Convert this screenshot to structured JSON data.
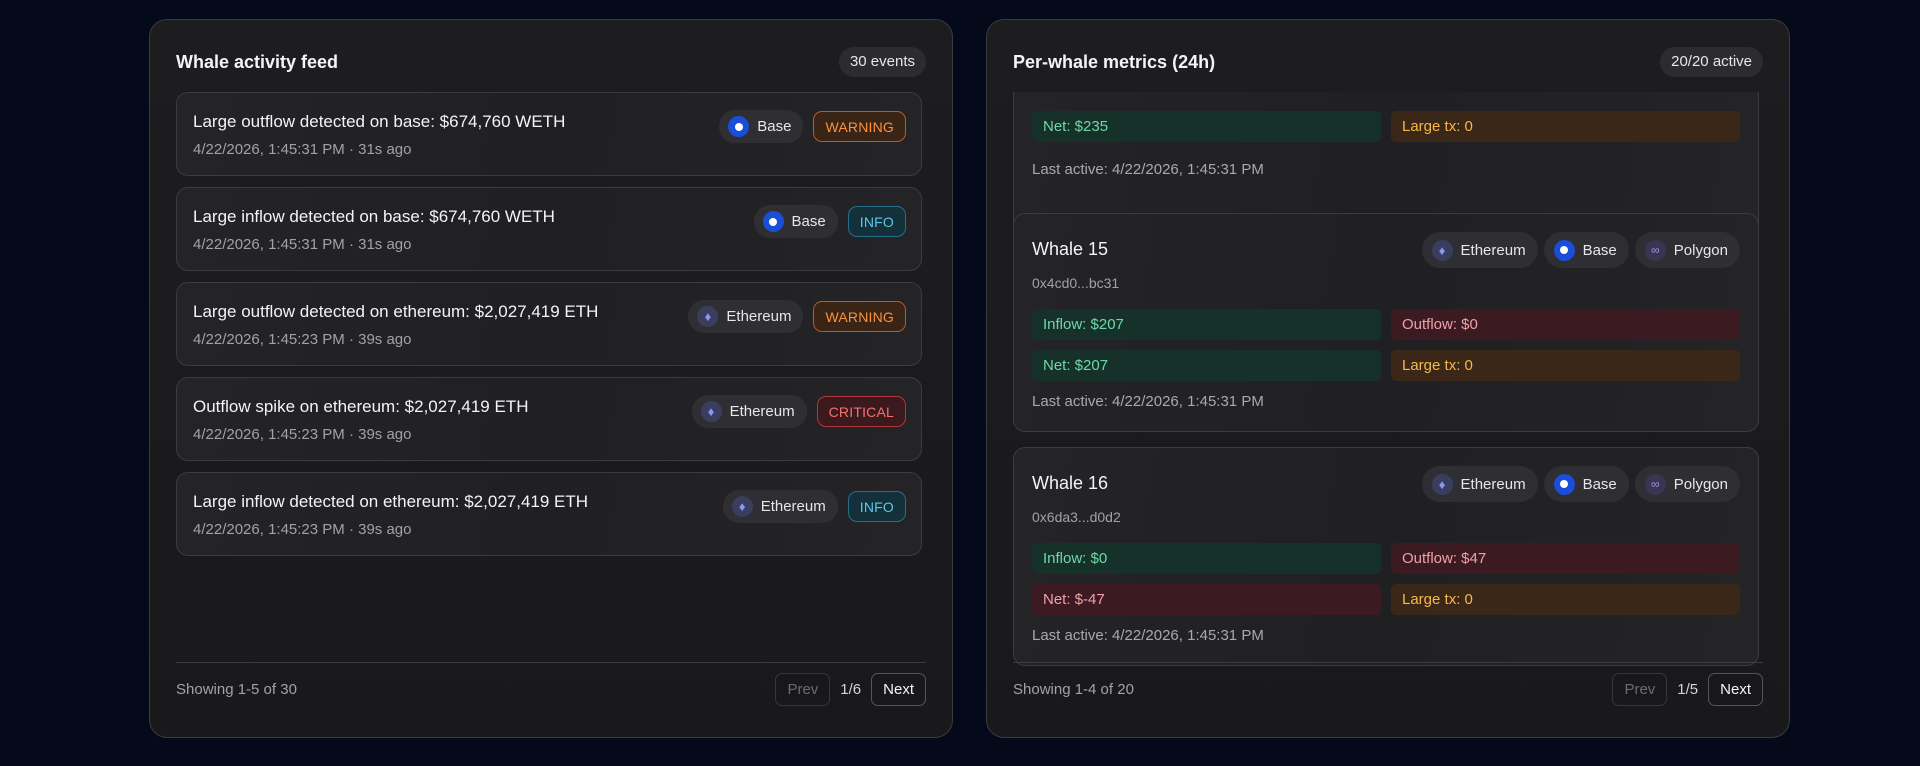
{
  "feed": {
    "title": "Whale activity feed",
    "count": "30 events",
    "items": [
      {
        "title": "Large outflow detected on base: $674,760 WETH",
        "meta": "4/22/2026, 1:45:31 PM · 31s ago",
        "chain": "Base",
        "chain_icon": "base-icon",
        "severity": "WARNING"
      },
      {
        "title": "Large inflow detected on base: $674,760 WETH",
        "meta": "4/22/2026, 1:45:31 PM · 31s ago",
        "chain": "Base",
        "chain_icon": "base-icon",
        "severity": "INFO"
      },
      {
        "title": "Large outflow detected on ethereum: $2,027,419 ETH",
        "meta": "4/22/2026, 1:45:23 PM · 39s ago",
        "chain": "Ethereum",
        "chain_icon": "ethereum-icon",
        "severity": "WARNING"
      },
      {
        "title": "Outflow spike on ethereum: $2,027,419 ETH",
        "meta": "4/22/2026, 1:45:23 PM · 39s ago",
        "chain": "Ethereum",
        "chain_icon": "ethereum-icon",
        "severity": "CRITICAL"
      },
      {
        "title": "Large inflow detected on ethereum: $2,027,419 ETH",
        "meta": "4/22/2026, 1:45:23 PM · 39s ago",
        "chain": "Ethereum",
        "chain_icon": "ethereum-icon",
        "severity": "INFO"
      }
    ],
    "footer": {
      "showing": "Showing 1-5 of 30",
      "prev": "Prev",
      "page": "1/6",
      "next": "Next"
    }
  },
  "metrics": {
    "title": "Per-whale metrics (24h)",
    "count": "20/20 active",
    "partial_card": {
      "net": "Net: $235",
      "large_tx": "Large tx: 0",
      "last_active": "Last active: 4/22/2026, 1:45:31 PM"
    },
    "whales": [
      {
        "name": "Whale 15",
        "address": "0x4cd0...bc31",
        "chains": [
          "Ethereum",
          "Base",
          "Polygon"
        ],
        "inflow": "Inflow: $207",
        "outflow": "Outflow: $0",
        "net": "Net: $207",
        "net_status": "positive",
        "large_tx": "Large tx: 0",
        "last_active": "Last active: 4/22/2026, 1:45:31 PM"
      },
      {
        "name": "Whale 16",
        "address": "0x6da3...d0d2",
        "chains": [
          "Ethereum",
          "Base",
          "Polygon"
        ],
        "inflow": "Inflow: $0",
        "outflow": "Outflow: $47",
        "net": "Net: $-47",
        "net_status": "negative",
        "large_tx": "Large tx: 0",
        "last_active": "Last active: 4/22/2026, 1:45:31 PM"
      }
    ],
    "footer": {
      "showing": "Showing 1-4 of 20",
      "prev": "Prev",
      "page": "1/5",
      "next": "Next"
    }
  },
  "colors": {
    "background": "#050a1b",
    "warning": "#fb923c",
    "info": "#5ec8e5",
    "critical": "#f87171",
    "positive": "#6fd9a6",
    "negative": "#f0a0a6",
    "large_tx": "#f7b84a"
  }
}
